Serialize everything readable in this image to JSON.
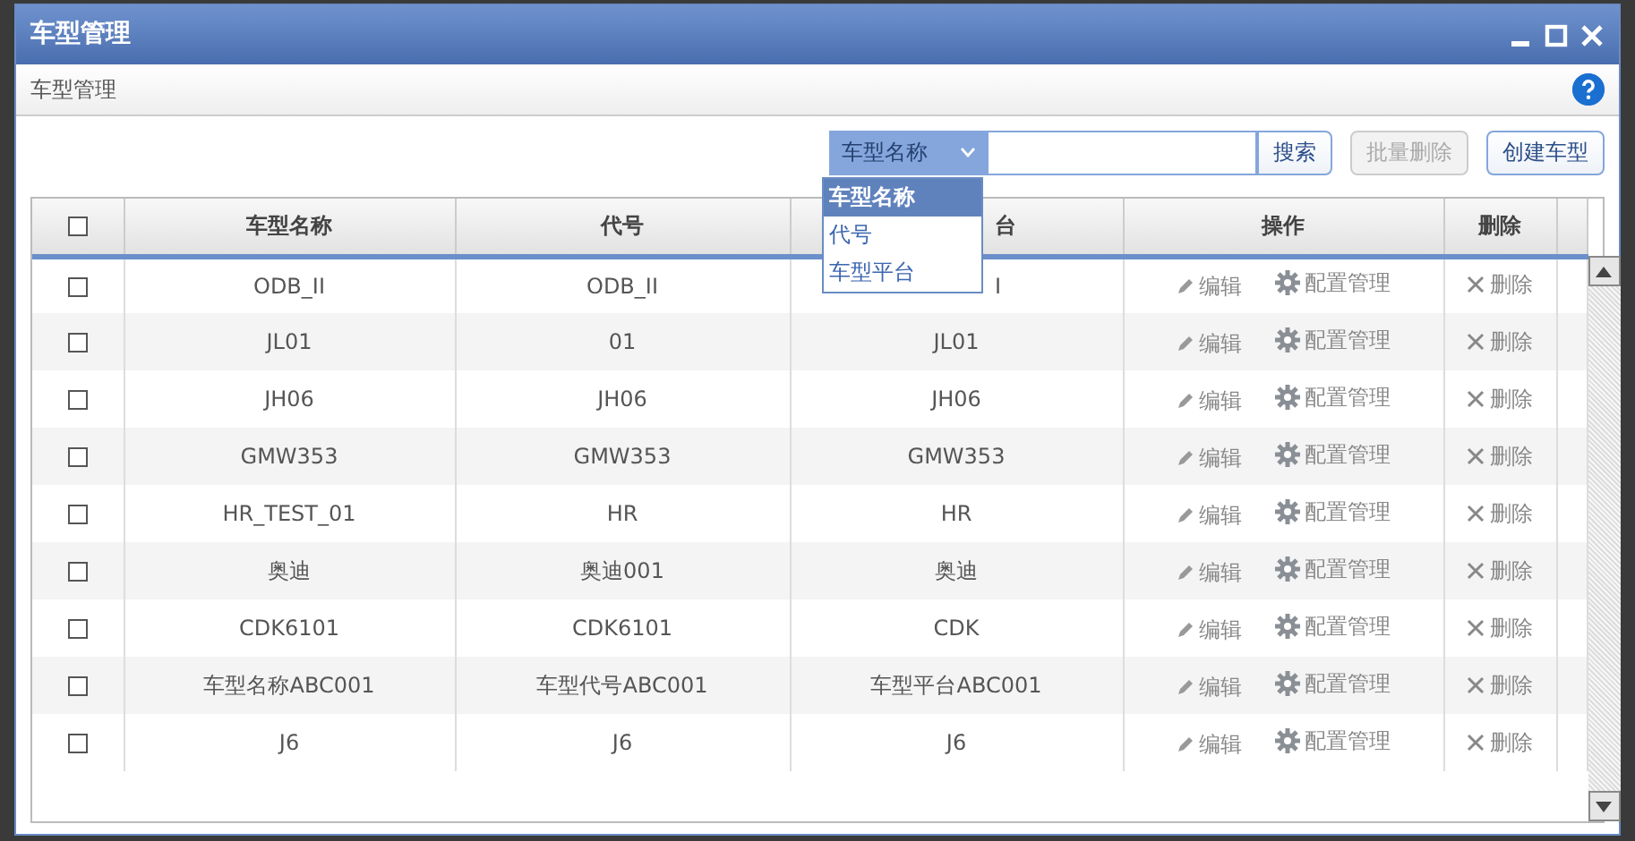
{
  "window": {
    "title": "车型管理"
  },
  "breadcrumb": "车型管理",
  "toolbar": {
    "field_select": {
      "value": "车型名称",
      "expanded": true,
      "options": [
        {
          "label": "车型名称",
          "selected": true
        },
        {
          "label": "代号",
          "selected": false
        },
        {
          "label": "车型平台",
          "selected": false
        }
      ]
    },
    "search_button": "搜索",
    "buttons": [
      {
        "label": "批量删除",
        "disabled": true
      },
      {
        "label": "创建车型",
        "disabled": false
      }
    ]
  },
  "table": {
    "select_all_checked": false,
    "columns": [
      {
        "label": "车型名称"
      },
      {
        "label": "代号"
      },
      {
        "label": "台",
        "partial": true
      },
      {
        "label": "操作"
      },
      {
        "label": "删除"
      }
    ],
    "rows": [
      {
        "checked": false,
        "cells": [
          {
            "text": "ODB_II"
          },
          {
            "text": "ODB_II"
          },
          {
            "text": "I",
            "partial": true
          }
        ],
        "edit": "编辑",
        "config": "配置管理",
        "delete": "删除"
      },
      {
        "checked": false,
        "cells": [
          {
            "text": "JL01"
          },
          {
            "text": "01"
          },
          {
            "text": "JL01"
          }
        ],
        "edit": "编辑",
        "config": "配置管理",
        "delete": "删除"
      },
      {
        "checked": false,
        "cells": [
          {
            "text": "JH06"
          },
          {
            "text": "JH06"
          },
          {
            "text": "JH06"
          }
        ],
        "edit": "编辑",
        "config": "配置管理",
        "delete": "删除"
      },
      {
        "checked": false,
        "cells": [
          {
            "text": "GMW353"
          },
          {
            "text": "GMW353"
          },
          {
            "text": "GMW353"
          }
        ],
        "edit": "编辑",
        "config": "配置管理",
        "delete": "删除"
      },
      {
        "checked": false,
        "cells": [
          {
            "text": "HR_TEST_01"
          },
          {
            "text": "HR"
          },
          {
            "text": "HR"
          }
        ],
        "edit": "编辑",
        "config": "配置管理",
        "delete": "删除"
      },
      {
        "checked": false,
        "cells": [
          {
            "text": "奥迪"
          },
          {
            "text": "奥迪001"
          },
          {
            "text": "奥迪"
          }
        ],
        "edit": "编辑",
        "config": "配置管理",
        "delete": "删除"
      },
      {
        "checked": false,
        "cells": [
          {
            "text": "CDK6101"
          },
          {
            "text": "CDK6101"
          },
          {
            "text": "CDK"
          }
        ],
        "edit": "编辑",
        "config": "配置管理",
        "delete": "删除"
      },
      {
        "checked": false,
        "cells": [
          {
            "text": "车型名称ABC001"
          },
          {
            "text": "车型代号ABC001"
          },
          {
            "text": "车型平台ABC001"
          }
        ],
        "edit": "编辑",
        "config": "配置管理",
        "delete": "删除"
      },
      {
        "checked": false,
        "cells": [
          {
            "text": "J6"
          },
          {
            "text": "J6"
          },
          {
            "text": "J6"
          }
        ],
        "edit": "编辑",
        "config": "配置管理",
        "delete": "删除"
      }
    ]
  }
}
